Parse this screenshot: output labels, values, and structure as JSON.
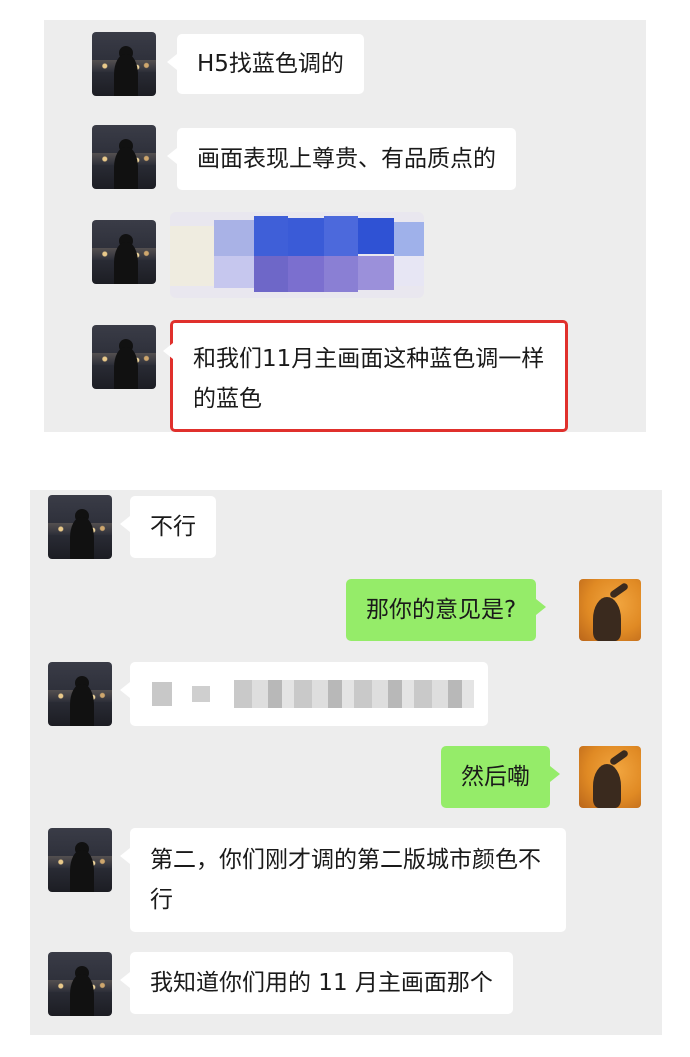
{
  "top_chat": {
    "messages": [
      {
        "text": "H5找蓝色调的"
      },
      {
        "text": "画面表现上尊贵、有品质点的"
      },
      {
        "text": "和我们11月主画面这种蓝色调一样的蓝色"
      }
    ],
    "redacted_image": "pixelated-image-message",
    "highlight_color": "#e0302c"
  },
  "bottom_chat": {
    "messages": [
      {
        "side": "left",
        "text": "不行"
      },
      {
        "side": "right",
        "text": "那你的意见是?"
      },
      {
        "side": "left",
        "text": "",
        "redacted": true
      },
      {
        "side": "right",
        "text": "然后嘞"
      },
      {
        "side": "left",
        "text": "第二，你们刚才调的第二版城市颜色不行"
      },
      {
        "side": "left",
        "text": "我知道你们用的 11 月主画面那个"
      }
    ],
    "colors": {
      "my_bubble": "#95ec69",
      "their_bubble": "#ffffff",
      "background": "#ededed"
    }
  }
}
